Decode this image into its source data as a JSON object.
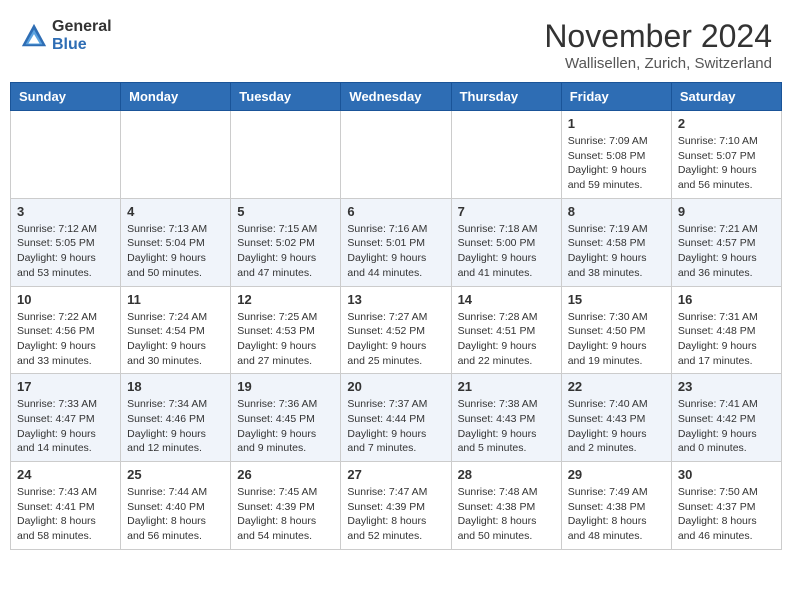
{
  "header": {
    "logo_general": "General",
    "logo_blue": "Blue",
    "month_title": "November 2024",
    "location": "Wallisellen, Zurich, Switzerland"
  },
  "weekdays": [
    "Sunday",
    "Monday",
    "Tuesday",
    "Wednesday",
    "Thursday",
    "Friday",
    "Saturday"
  ],
  "weeks": [
    [
      {
        "day": "",
        "info": ""
      },
      {
        "day": "",
        "info": ""
      },
      {
        "day": "",
        "info": ""
      },
      {
        "day": "",
        "info": ""
      },
      {
        "day": "",
        "info": ""
      },
      {
        "day": "1",
        "info": "Sunrise: 7:09 AM\nSunset: 5:08 PM\nDaylight: 9 hours and 59 minutes."
      },
      {
        "day": "2",
        "info": "Sunrise: 7:10 AM\nSunset: 5:07 PM\nDaylight: 9 hours and 56 minutes."
      }
    ],
    [
      {
        "day": "3",
        "info": "Sunrise: 7:12 AM\nSunset: 5:05 PM\nDaylight: 9 hours and 53 minutes."
      },
      {
        "day": "4",
        "info": "Sunrise: 7:13 AM\nSunset: 5:04 PM\nDaylight: 9 hours and 50 minutes."
      },
      {
        "day": "5",
        "info": "Sunrise: 7:15 AM\nSunset: 5:02 PM\nDaylight: 9 hours and 47 minutes."
      },
      {
        "day": "6",
        "info": "Sunrise: 7:16 AM\nSunset: 5:01 PM\nDaylight: 9 hours and 44 minutes."
      },
      {
        "day": "7",
        "info": "Sunrise: 7:18 AM\nSunset: 5:00 PM\nDaylight: 9 hours and 41 minutes."
      },
      {
        "day": "8",
        "info": "Sunrise: 7:19 AM\nSunset: 4:58 PM\nDaylight: 9 hours and 38 minutes."
      },
      {
        "day": "9",
        "info": "Sunrise: 7:21 AM\nSunset: 4:57 PM\nDaylight: 9 hours and 36 minutes."
      }
    ],
    [
      {
        "day": "10",
        "info": "Sunrise: 7:22 AM\nSunset: 4:56 PM\nDaylight: 9 hours and 33 minutes."
      },
      {
        "day": "11",
        "info": "Sunrise: 7:24 AM\nSunset: 4:54 PM\nDaylight: 9 hours and 30 minutes."
      },
      {
        "day": "12",
        "info": "Sunrise: 7:25 AM\nSunset: 4:53 PM\nDaylight: 9 hours and 27 minutes."
      },
      {
        "day": "13",
        "info": "Sunrise: 7:27 AM\nSunset: 4:52 PM\nDaylight: 9 hours and 25 minutes."
      },
      {
        "day": "14",
        "info": "Sunrise: 7:28 AM\nSunset: 4:51 PM\nDaylight: 9 hours and 22 minutes."
      },
      {
        "day": "15",
        "info": "Sunrise: 7:30 AM\nSunset: 4:50 PM\nDaylight: 9 hours and 19 minutes."
      },
      {
        "day": "16",
        "info": "Sunrise: 7:31 AM\nSunset: 4:48 PM\nDaylight: 9 hours and 17 minutes."
      }
    ],
    [
      {
        "day": "17",
        "info": "Sunrise: 7:33 AM\nSunset: 4:47 PM\nDaylight: 9 hours and 14 minutes."
      },
      {
        "day": "18",
        "info": "Sunrise: 7:34 AM\nSunset: 4:46 PM\nDaylight: 9 hours and 12 minutes."
      },
      {
        "day": "19",
        "info": "Sunrise: 7:36 AM\nSunset: 4:45 PM\nDaylight: 9 hours and 9 minutes."
      },
      {
        "day": "20",
        "info": "Sunrise: 7:37 AM\nSunset: 4:44 PM\nDaylight: 9 hours and 7 minutes."
      },
      {
        "day": "21",
        "info": "Sunrise: 7:38 AM\nSunset: 4:43 PM\nDaylight: 9 hours and 5 minutes."
      },
      {
        "day": "22",
        "info": "Sunrise: 7:40 AM\nSunset: 4:43 PM\nDaylight: 9 hours and 2 minutes."
      },
      {
        "day": "23",
        "info": "Sunrise: 7:41 AM\nSunset: 4:42 PM\nDaylight: 9 hours and 0 minutes."
      }
    ],
    [
      {
        "day": "24",
        "info": "Sunrise: 7:43 AM\nSunset: 4:41 PM\nDaylight: 8 hours and 58 minutes."
      },
      {
        "day": "25",
        "info": "Sunrise: 7:44 AM\nSunset: 4:40 PM\nDaylight: 8 hours and 56 minutes."
      },
      {
        "day": "26",
        "info": "Sunrise: 7:45 AM\nSunset: 4:39 PM\nDaylight: 8 hours and 54 minutes."
      },
      {
        "day": "27",
        "info": "Sunrise: 7:47 AM\nSunset: 4:39 PM\nDaylight: 8 hours and 52 minutes."
      },
      {
        "day": "28",
        "info": "Sunrise: 7:48 AM\nSunset: 4:38 PM\nDaylight: 8 hours and 50 minutes."
      },
      {
        "day": "29",
        "info": "Sunrise: 7:49 AM\nSunset: 4:38 PM\nDaylight: 8 hours and 48 minutes."
      },
      {
        "day": "30",
        "info": "Sunrise: 7:50 AM\nSunset: 4:37 PM\nDaylight: 8 hours and 46 minutes."
      }
    ]
  ]
}
